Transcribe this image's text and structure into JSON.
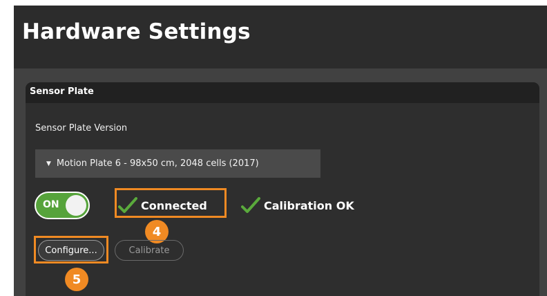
{
  "header": {
    "title": "Hardware Settings"
  },
  "panel": {
    "title": "Sensor Plate",
    "version_label": "Sensor Plate Version",
    "version_selected": "Motion Plate 6 - 98x50 cm, 2048 cells (2017)",
    "toggle": {
      "label": "ON",
      "state": true
    },
    "status": {
      "connected": "Connected",
      "calibration": "Calibration OK"
    },
    "buttons": {
      "configure": "Configure...",
      "calibrate": "Calibrate"
    }
  },
  "annotations": {
    "step_4": "4",
    "step_5": "5"
  },
  "colors": {
    "highlight": "#f08a23",
    "toggle_on": "#56a33b",
    "check": "#5aaa3c"
  },
  "icons": {
    "dropdown": "caret-down-icon",
    "status": "checkmark-icon"
  }
}
